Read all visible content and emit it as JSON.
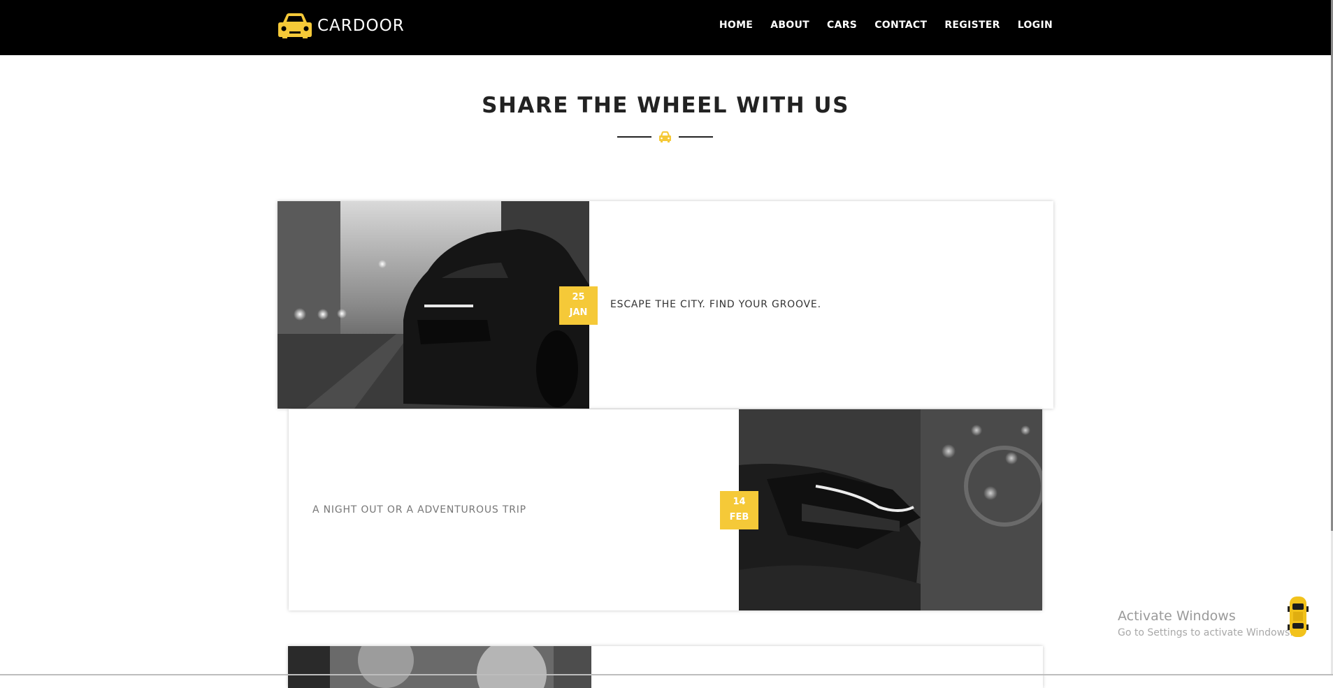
{
  "brand": {
    "name": "CARDOOR",
    "icon": "car-logo-icon"
  },
  "nav": [
    {
      "label": "HOME"
    },
    {
      "label": "ABOUT"
    },
    {
      "label": "CARS"
    },
    {
      "label": "CONTACT"
    },
    {
      "label": "REGISTER"
    },
    {
      "label": "LOGIN"
    }
  ],
  "section": {
    "title": "SHARE THE WHEEL WITH US",
    "divider_icon": "car-icon"
  },
  "posts": [
    {
      "day": "25",
      "month": "JAN",
      "title": "ESCAPE THE CITY. FIND YOUR GROOVE.",
      "image": "black-sports-car-rear-street-photo"
    },
    {
      "day": "14",
      "month": "FEB",
      "title": "A NIGHT OUT OR A ADVENTUROUS TRIP",
      "image": "car-taillight-night-photo"
    },
    {
      "image": "grayscale-car-photo"
    }
  ],
  "watermark": {
    "title": "Activate Windows",
    "subtitle": "Go to Settings to activate Windows."
  },
  "floating_widget": {
    "icon": "yellow-taxi-icon"
  },
  "colors": {
    "accent": "#f5c938",
    "header_bg": "#000000",
    "title": "#222222"
  }
}
